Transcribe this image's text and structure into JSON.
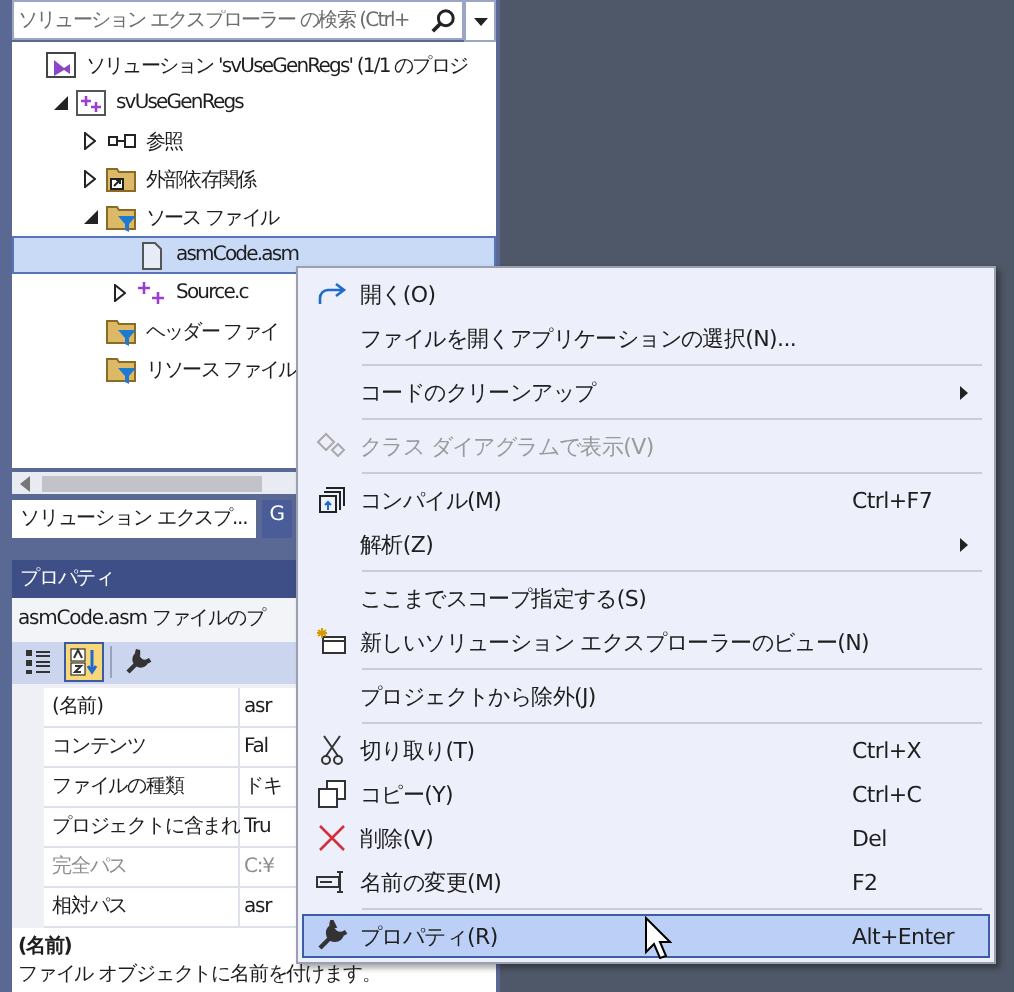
{
  "search": {
    "placeholder": "ソリューション エクスプローラー の検索 (Ctrl+"
  },
  "tree": [
    {
      "label": "ソリューション 'svUseGenRegs' (1/1 のプロジ",
      "kind": "solution",
      "children": [
        {
          "label": "svUseGenRegs",
          "kind": "project",
          "expanded": true,
          "selected": false,
          "children": [
            {
              "label": "参照",
              "kind": "references",
              "expanded": false,
              "selected": false
            },
            {
              "label": "外部依存関係",
              "kind": "folder",
              "expanded": false,
              "selected": false
            },
            {
              "label": "ソース ファイル",
              "kind": "filter",
              "expanded": true,
              "selected": false,
              "children": [
                {
                  "label": "asmCode.asm",
                  "kind": "file",
                  "selected": true
                },
                {
                  "label": "Source.c",
                  "kind": "cpp",
                  "expanded": false,
                  "selected": false
                }
              ]
            },
            {
              "label": "ヘッダー ファイ",
              "kind": "filter",
              "selected": false
            },
            {
              "label": "リソース ファイル",
              "kind": "filter",
              "selected": false
            }
          ]
        }
      ]
    }
  ],
  "tabs": [
    {
      "label": "ソリューション エクスプ...",
      "selected": true
    },
    {
      "label": "G",
      "selected": false
    }
  ],
  "properties": {
    "title": "プロパティ",
    "subject": "asmCode.asm  ファイルのプ",
    "toolbar": [
      {
        "kind": "categorized",
        "selected": false
      },
      {
        "kind": "alphabetical",
        "selected": true
      },
      {
        "kind": "pages",
        "selected": false
      }
    ],
    "rows": [
      {
        "name": "(名前)",
        "value": "asr",
        "disabled": false
      },
      {
        "name": "コンテンツ",
        "value": "Fal",
        "disabled": false
      },
      {
        "name": "ファイルの種類",
        "value": "ドキ",
        "disabled": false
      },
      {
        "name": "プロジェクトに含まれ",
        "value": "Tru",
        "disabled": false
      },
      {
        "name": "完全パス",
        "value": "C:¥",
        "disabled": true
      },
      {
        "name": "相対パス",
        "value": "asr",
        "disabled": false
      }
    ],
    "description_title": "(名前)",
    "description": "ファイル オブジェクトに名前を付けます。"
  },
  "menu": [
    {
      "kind": "open",
      "label": "開く(O)",
      "disabled": false,
      "highlighted": false
    },
    {
      "kind": "text",
      "label": "ファイルを開くアプリケーションの選択(N)...",
      "disabled": false,
      "highlighted": false
    },
    {
      "kind": "separator"
    },
    {
      "kind": "text",
      "label": "コードのクリーンアップ",
      "submenu": true,
      "disabled": false,
      "highlighted": false
    },
    {
      "kind": "separator"
    },
    {
      "kind": "diagram",
      "label": "クラス ダイアグラムで表示(V)",
      "disabled": true,
      "highlighted": false
    },
    {
      "kind": "separator"
    },
    {
      "kind": "compile",
      "label": "コンパイル(M)",
      "shortcut": "Ctrl+F7",
      "disabled": false,
      "highlighted": false
    },
    {
      "kind": "text",
      "label": "解析(Z)",
      "submenu": true,
      "disabled": false,
      "highlighted": false
    },
    {
      "kind": "separator"
    },
    {
      "kind": "text",
      "label": "ここまでスコープ指定する(S)",
      "disabled": false,
      "highlighted": false
    },
    {
      "kind": "newview",
      "label": "新しいソリューション エクスプローラーのビュー(N)",
      "disabled": false,
      "highlighted": false
    },
    {
      "kind": "separator"
    },
    {
      "kind": "text",
      "label": "プロジェクトから除外(J)",
      "disabled": false,
      "highlighted": false
    },
    {
      "kind": "separator"
    },
    {
      "kind": "cut",
      "label": "切り取り(T)",
      "shortcut": "Ctrl+X",
      "disabled": false,
      "highlighted": false
    },
    {
      "kind": "copy",
      "label": "コピー(Y)",
      "shortcut": "Ctrl+C",
      "disabled": false,
      "highlighted": false
    },
    {
      "kind": "delete",
      "label": "削除(V)",
      "shortcut": "Del",
      "disabled": false,
      "highlighted": false
    },
    {
      "kind": "rename",
      "label": "名前の変更(M)",
      "shortcut": "F2",
      "disabled": false,
      "highlighted": false
    },
    {
      "kind": "separator"
    },
    {
      "kind": "wrench",
      "label": "プロパティ(R)",
      "shortcut": "Alt+Enter",
      "disabled": false,
      "highlighted": true
    }
  ]
}
